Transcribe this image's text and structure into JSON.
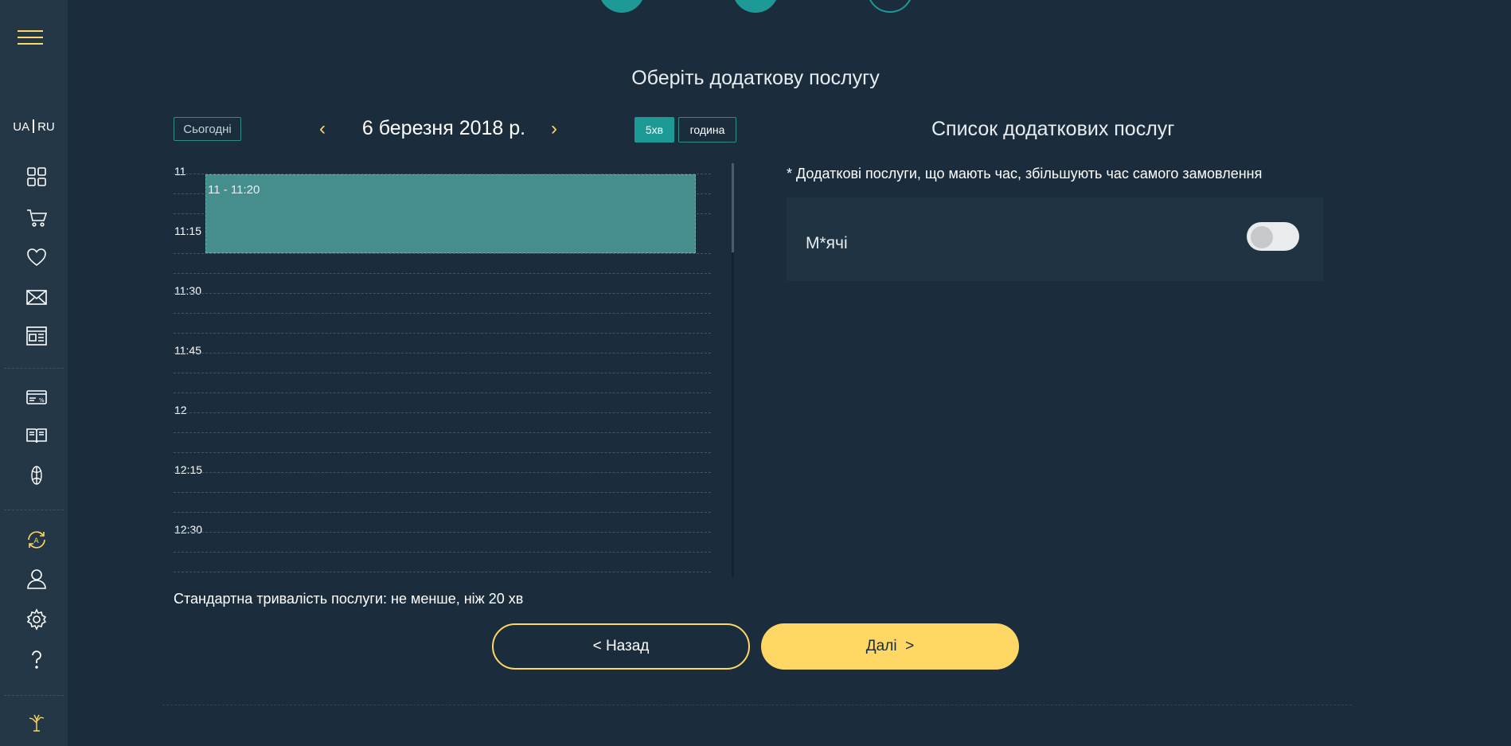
{
  "sidebar": {
    "lang_ua": "UA",
    "lang_ru": "RU"
  },
  "page": {
    "title": "Оберіть додаткову послугу"
  },
  "calendar": {
    "today_label": "Сьогодні",
    "prev_arrow": "‹",
    "next_arrow": "›",
    "date": "6 березня 2018 р.",
    "view_5min": "5хв",
    "view_hour": "година",
    "time_labels": [
      "11",
      "11:15",
      "11:30",
      "11:45",
      "12",
      "12:15",
      "12:30"
    ],
    "event_label": "11 - 11:20"
  },
  "std_duration": "Стандартна тривалість послуги: не менше, ніж 20 хв",
  "services": {
    "title": "Список додаткових послуг",
    "note": "* Додаткові послуги, що мають час, збільшують час самого замовлення",
    "items": [
      {
        "name": "М*ячі",
        "enabled": false
      }
    ]
  },
  "nav": {
    "back_label": "< Назад",
    "next_label": "Далі  >"
  },
  "colors": {
    "background": "#1b2d3d",
    "sidebar": "#233746",
    "accent_yellow": "#ffd764",
    "accent_teal": "#1d9a95"
  }
}
